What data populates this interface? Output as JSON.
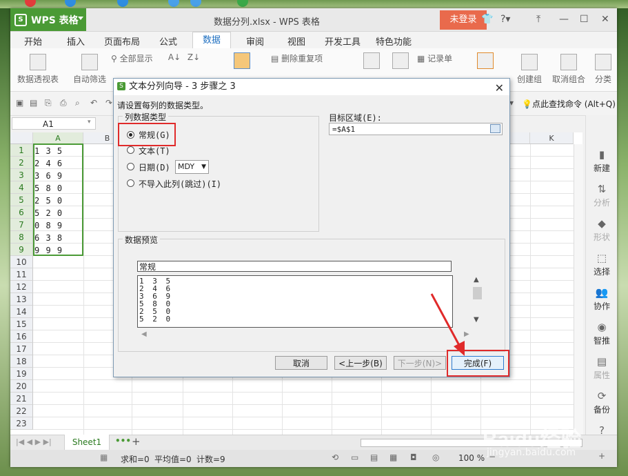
{
  "app": {
    "name": "WPS 表格",
    "document_title": "数据分列.xlsx - WPS 表格",
    "login_label": "未登录"
  },
  "menu": {
    "items": [
      "开始",
      "插入",
      "页面布局",
      "公式",
      "数据",
      "审阅",
      "视图",
      "开发工具",
      "特色功能"
    ],
    "active": "数据"
  },
  "ribbon": {
    "pivot": "数据透视表",
    "autofilter": "自动筛选",
    "show_all": "全部显示",
    "remove_duplicates": "删除重复项",
    "record": "记录单",
    "group": "创建组",
    "ungroup": "取消组合",
    "subtotal": "分类"
  },
  "quickbar": {
    "find_command": "点此查找命令 (Alt+Q)"
  },
  "namebox": "A1",
  "columns": [
    "A",
    "B",
    "K"
  ],
  "rows": [
    "1",
    "2",
    "3",
    "4",
    "5",
    "6",
    "7",
    "8",
    "9",
    "10",
    "11",
    "12",
    "13",
    "14",
    "15",
    "16",
    "17",
    "18",
    "19",
    "20",
    "21",
    "22",
    "23"
  ],
  "cells": [
    "1 3 5",
    "2 4 6",
    "3 6 9",
    "5 8 0",
    "2 5 0",
    "5 2 0",
    "0 8 9",
    "6 3 8",
    "9 9 9"
  ],
  "sidebar": {
    "new": "新建",
    "analyze": "分析",
    "shape": "形状",
    "select": "选择",
    "collab": "协作",
    "smart": "智推",
    "attributes": "属性",
    "backup": "备份",
    "help": "帮助"
  },
  "sheet_tab": "Sheet1",
  "status": {
    "sum": "求和=0",
    "average": "平均值=0",
    "count": "计数=9",
    "zoom": "100 %"
  },
  "watermark": {
    "brand": "Baidu经验",
    "url": "jingyan.baidu.com"
  },
  "dialog": {
    "title": "文本分列向导 - 3 步骤之 3",
    "prompt": "请设置每列的数据类型。",
    "col_type_label": "列数据类型",
    "options": {
      "general": "常规(G)",
      "text": "文本(T)",
      "date": "日期(D)",
      "skip": "不导入此列(跳过)(I)"
    },
    "date_format": "MDY",
    "target_label": "目标区域(E):",
    "target_value": "=$A$1",
    "preview_label": "数据预览",
    "preview_header": "常规",
    "preview_rows": [
      "1 3 5",
      "2 4 6",
      "3 6 9",
      "5 8 0",
      "2 5 0",
      "5 2 0"
    ],
    "buttons": {
      "cancel": "取消",
      "back": "<上一步(B)",
      "next": "下一步(N)>",
      "finish": "完成(F)"
    }
  },
  "colors": {
    "brand_green": "#4a9a35",
    "login_orange": "#e96a4c",
    "highlight_red": "#e02a2a"
  }
}
